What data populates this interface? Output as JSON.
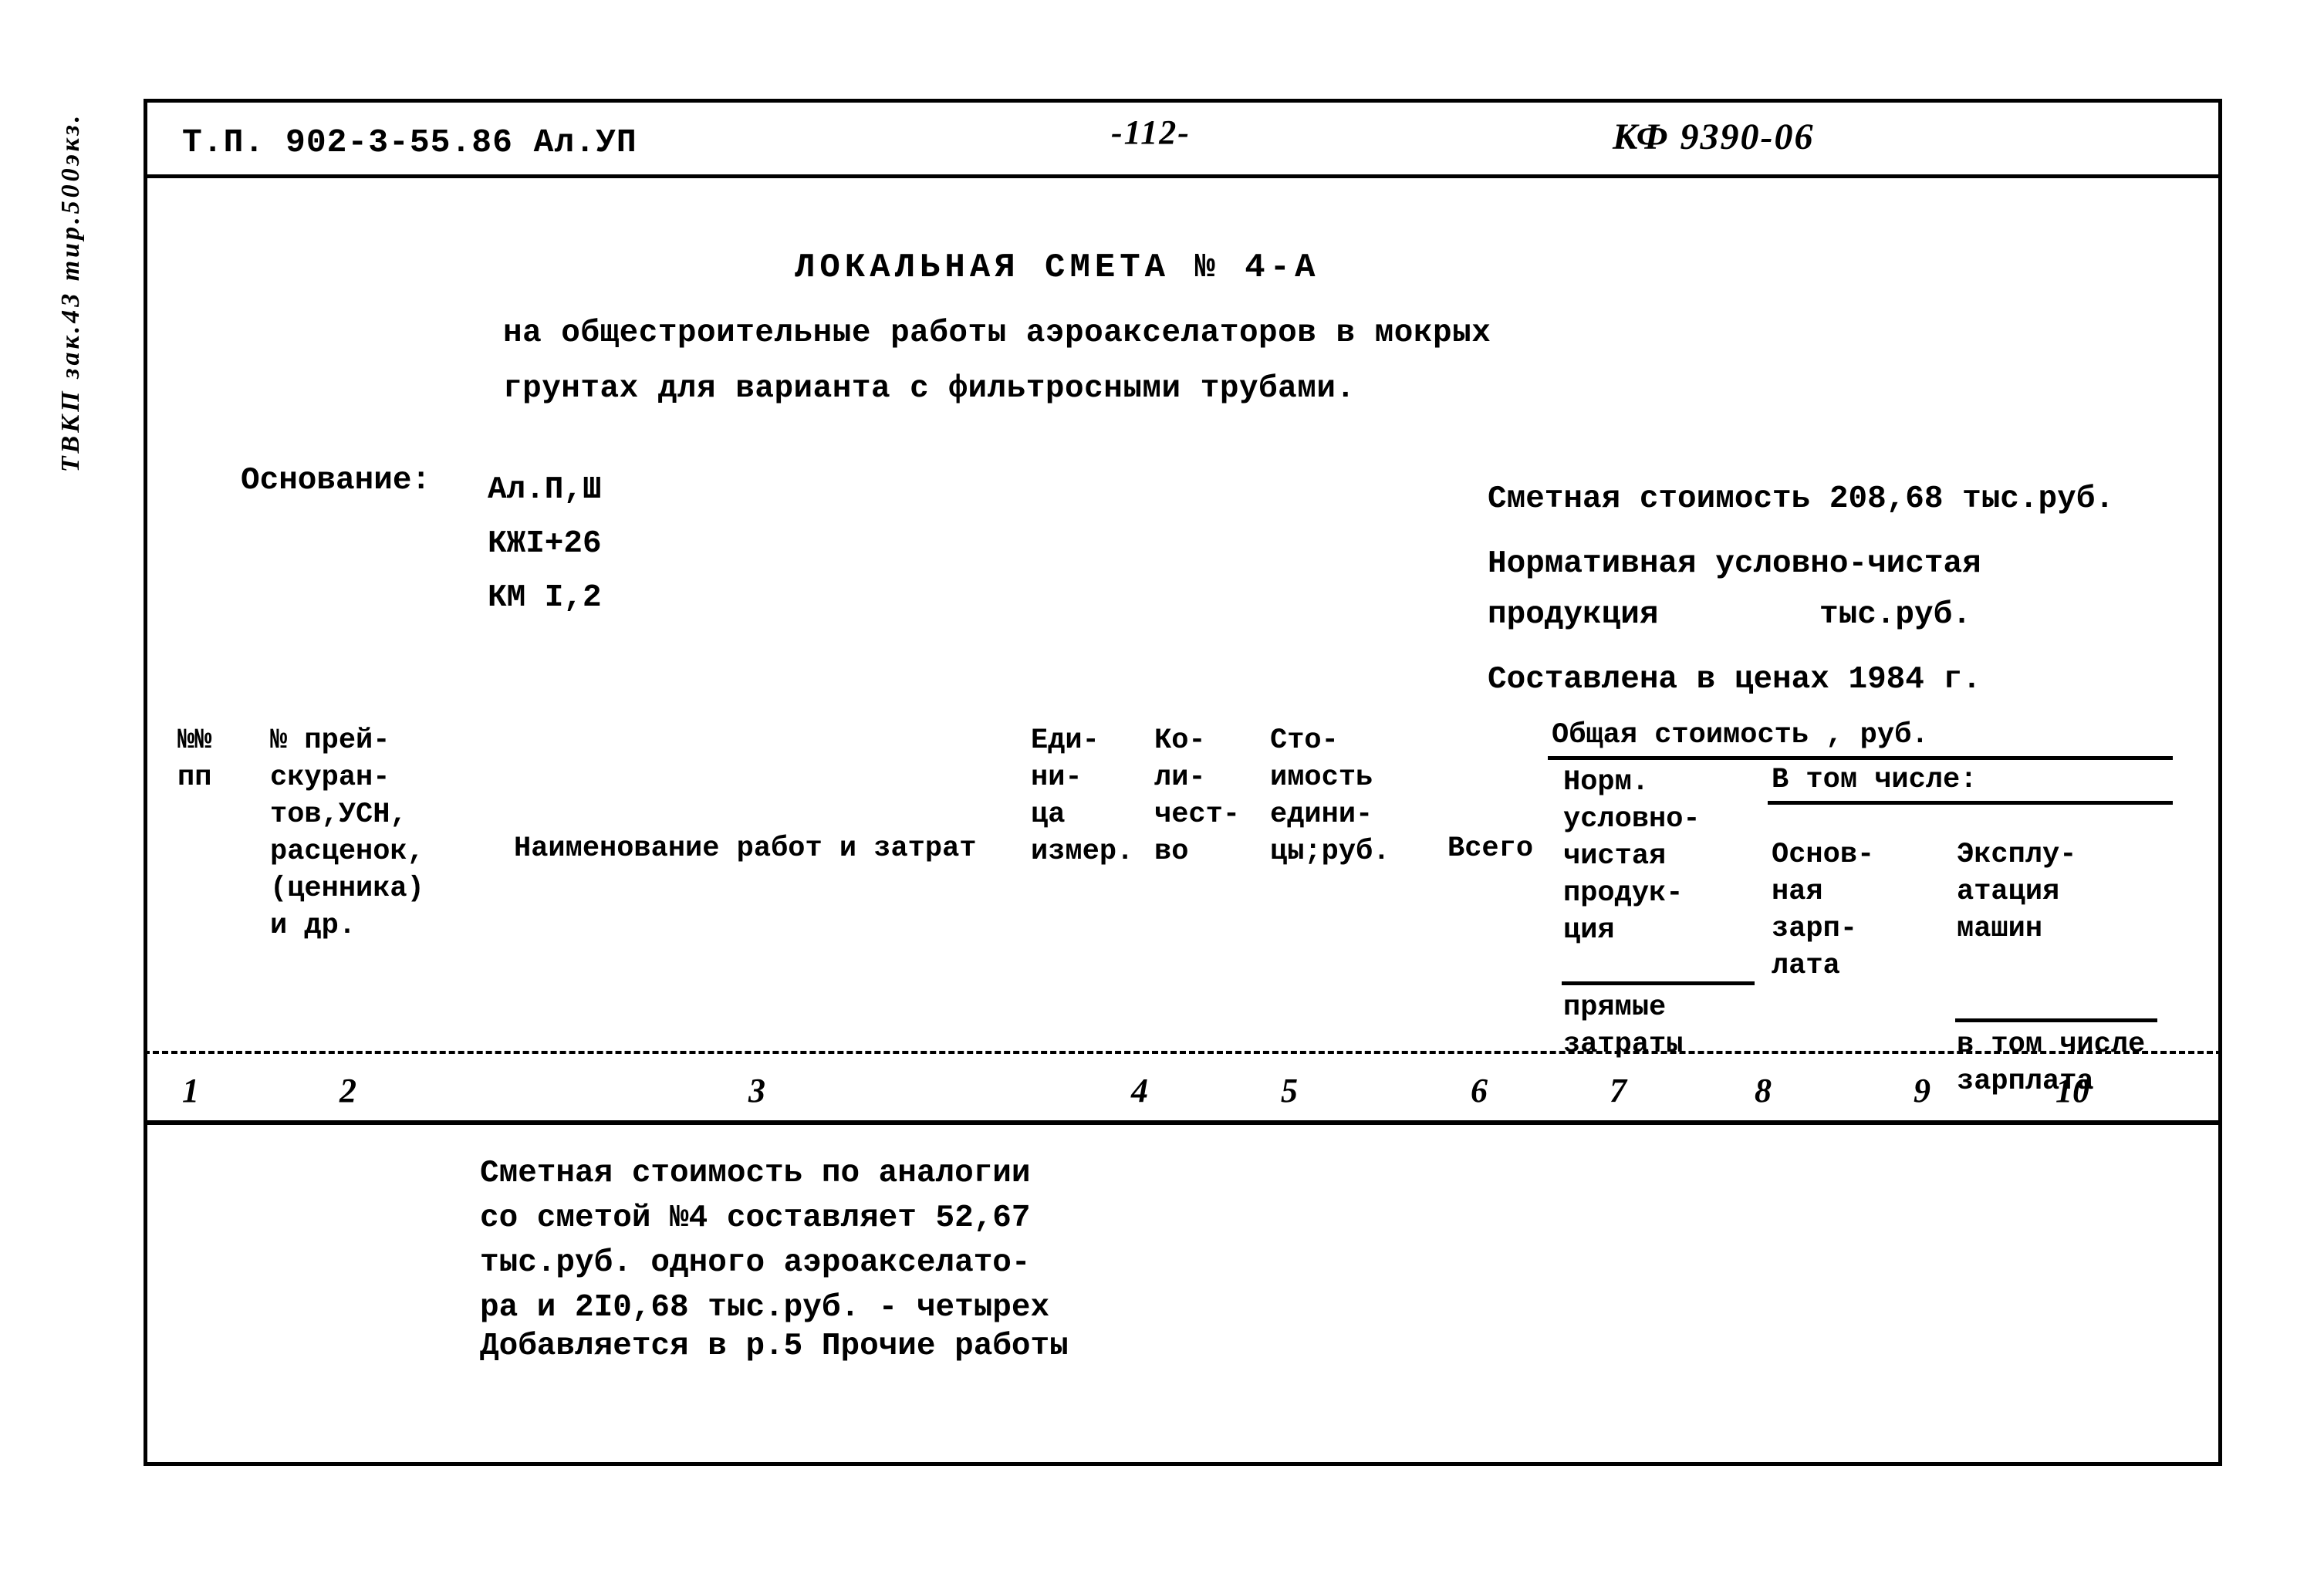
{
  "margin_note": "ТВКП зак.43 тир.500экз.",
  "header": {
    "left": "Т.П.  902-3-55.86  Ал.УП",
    "page": "-112-",
    "right": "КФ 9390-06"
  },
  "title": "ЛОКАЛЬНАЯ СМЕТА  № 4-А",
  "subtitle_lines": [
    "на общестроительные работы аэроакселаторов в мокрых",
    "грунтах для варианта с фильтросными трубами."
  ],
  "basis": {
    "label": "Основание:",
    "values": [
      "Ал.П,Ш",
      "КЖI+26",
      "КМ I,2"
    ]
  },
  "cost_summary": {
    "estimate_cost": "Сметная стоимость 208,68 тыс.руб.",
    "net_product_line1": "Нормативная условно-чистая",
    "net_product_label": "продукция",
    "net_product_units": "тыс.руб.",
    "price_year": "Составлена в ценах 1984 г."
  },
  "table": {
    "headers": {
      "nn": "№№\nпп",
      "price_ref": "№ прей-\nскуран-\nтов,УСН,\nрасценок,\n(ценника)\nи др.",
      "name": "Наименование работ и затрат",
      "unit": "Еди-\nни-\nца\nизмер.",
      "qty": "Ко-\nли-\nчест-\nво",
      "unit_cost": "Сто-\nимость\nедини-\nцы;руб.",
      "group": "Общая стоимость , руб.",
      "total": "Всего",
      "norm": "Норм.\nусловно-\nчистая\nпродук-\nция",
      "direct": "прямые\nзатраты",
      "incl": "В том числе:",
      "basic_wage": "Основ-\nная\nзарп-\nлата",
      "machines": "Эксплу-\nатация\nмашин",
      "machines_wage": "в том числе\nзарплата"
    },
    "column_numbers": [
      "1",
      "2",
      "3",
      "4",
      "5",
      "6",
      "7",
      "8",
      "9",
      "10"
    ]
  },
  "body_note": {
    "lines": [
      "Сметная стоимость по аналогии",
      "со сметой №4 составляет 52,67",
      "тыс.руб. одного аэроакселато-",
      "ра и 2I0,68 тыс.руб. - четырех"
    ],
    "extra": "Добавляется в р.5 Прочие работы"
  }
}
